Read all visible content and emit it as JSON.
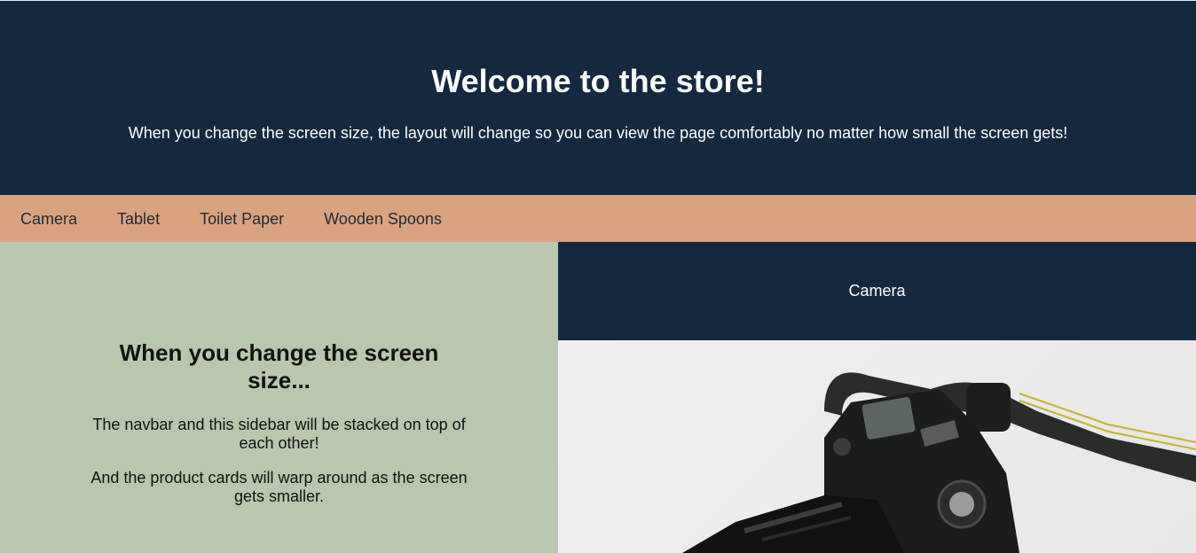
{
  "header": {
    "title": "Welcome to the store!",
    "subtitle": "When you change the screen size, the layout will change so you can view the page comfortably no matter how small the screen gets!"
  },
  "navbar": {
    "items": [
      {
        "label": "Camera"
      },
      {
        "label": "Tablet"
      },
      {
        "label": "Toilet Paper"
      },
      {
        "label": "Wooden Spoons"
      }
    ]
  },
  "sidebar": {
    "heading": "When you change the screen size...",
    "paragraph_1": "The navbar and this sidebar will be stacked on top of each other!",
    "paragraph_2": "And the product cards will warp around as the screen gets smaller."
  },
  "product_card": {
    "title": "Camera",
    "image": "camera-photo"
  },
  "colors": {
    "header_bg": "#14293f",
    "navbar_bg": "#d8a37e",
    "sidebar_bg": "#b8c7ad",
    "card_title_bg": "#14293f"
  }
}
